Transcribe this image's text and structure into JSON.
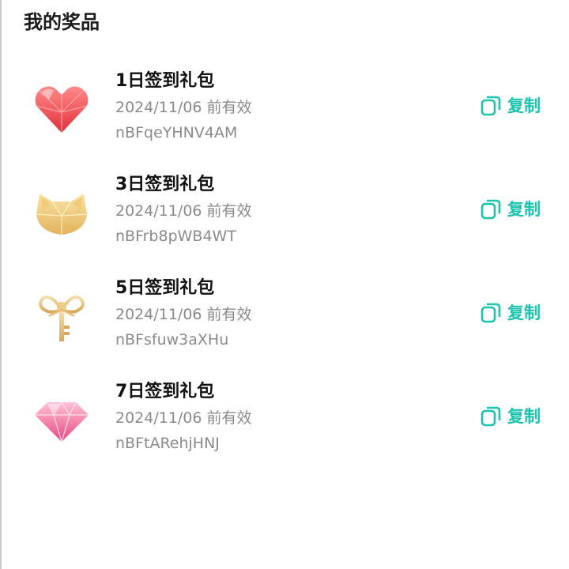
{
  "page": {
    "title": "我的奖品"
  },
  "copy_label": "复制",
  "accent_color": "#1cc4ad",
  "prizes": [
    {
      "name": "1日签到礼包",
      "expiry": "2024/11/06 前有效",
      "code": "nBFqeYHNV4AM",
      "icon": "red-heart-icon"
    },
    {
      "name": "3日签到礼包",
      "expiry": "2024/11/06 前有效",
      "code": "nBFrb8pWB4WT",
      "icon": "gold-cat-icon"
    },
    {
      "name": "5日签到礼包",
      "expiry": "2024/11/06 前有效",
      "code": "nBFsfuw3aXHu",
      "icon": "gold-key-icon"
    },
    {
      "name": "7日签到礼包",
      "expiry": "2024/11/06 前有效",
      "code": "nBFtARehjHNJ",
      "icon": "pink-diamond-icon"
    }
  ]
}
